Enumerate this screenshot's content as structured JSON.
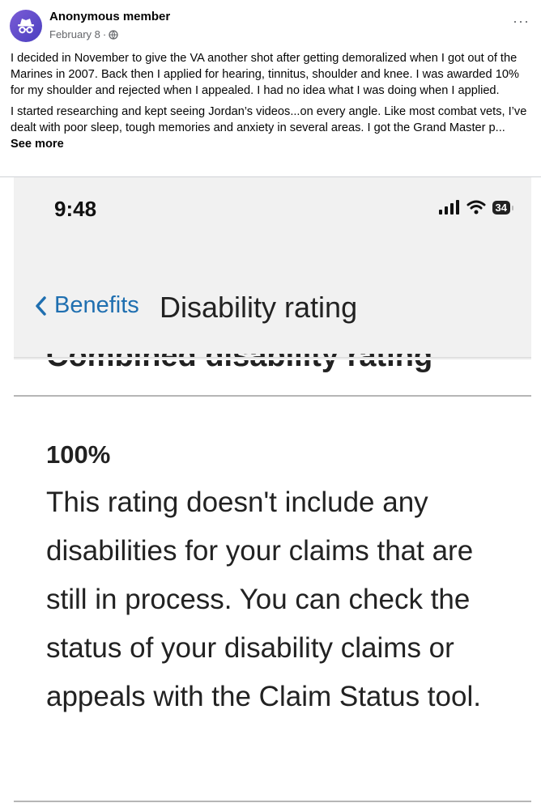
{
  "post": {
    "author": "Anonymous member",
    "date": "February 8",
    "separator": "·",
    "more_label": "···",
    "paragraphs": [
      "I decided in November to give the VA another shot after getting demoralized when I got out of the Marines in 2007. Back then I applied for hearing, tinnitus, shoulder and knee. I was awarded 10% for my shoulder and rejected when I appealed. I had no idea what I was doing when I applied.",
      "I started researching and kept seeing Jordan’s videos...on every angle. Like most combat vets, I’ve dealt with poor sleep, tough memories and anxiety in several areas. I got the Grand Master p..."
    ],
    "see_more": "See more",
    "icons": {
      "avatar": "anonymous-incognito-icon",
      "audience": "globe-icon",
      "menu": "more-options-icon"
    },
    "colors": {
      "avatar": "#5b47c9",
      "meta": "#65676b"
    }
  },
  "screenshot": {
    "time": "9:48",
    "battery": "34",
    "icons": {
      "signal": "cellular-signal-icon",
      "wifi": "wifi-icon",
      "battery": "battery-icon",
      "back": "chevron-left-icon"
    },
    "nav": {
      "back_label": "Benefits",
      "title": "Disability rating"
    },
    "section_heading": "Combined disability rating",
    "rating_value": "100%",
    "rating_description": "This rating doesn't include any disabilities for your claims that are still in process. You can check the status of your disability claims or appeals with the Claim Status tool.",
    "colors": {
      "link": "#1f6fb0",
      "background": "#f1f1f1"
    }
  }
}
